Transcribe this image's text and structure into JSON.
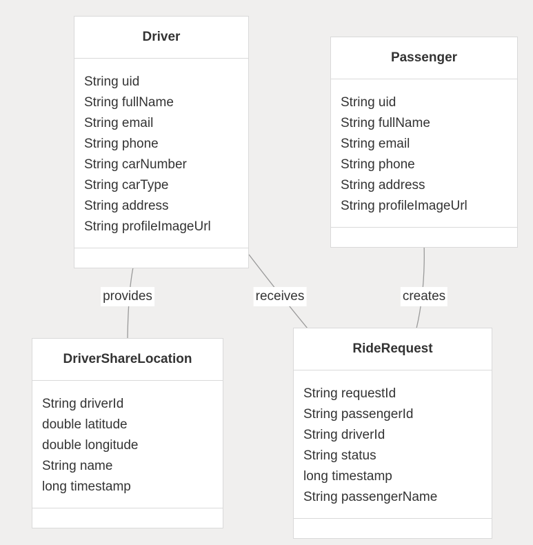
{
  "classes": {
    "driver": {
      "name": "Driver",
      "attributes": [
        "String uid",
        "String fullName",
        "String email",
        "String phone",
        "String carNumber",
        "String carType",
        "String address",
        "String profileImageUrl"
      ]
    },
    "passenger": {
      "name": "Passenger",
      "attributes": [
        "String uid",
        "String fullName",
        "String email",
        "String phone",
        "String address",
        "String profileImageUrl"
      ]
    },
    "driver_share_location": {
      "name": "DriverShareLocation",
      "attributes": [
        "String driverId",
        "double latitude",
        "double longitude",
        "String name",
        "long timestamp"
      ]
    },
    "ride_request": {
      "name": "RideRequest",
      "attributes": [
        "String requestId",
        "String passengerId",
        "String driverId",
        "String status",
        "long timestamp",
        "String passengerName"
      ]
    }
  },
  "relationships": {
    "provides": "provides",
    "receives": "receives",
    "creates": "creates"
  }
}
